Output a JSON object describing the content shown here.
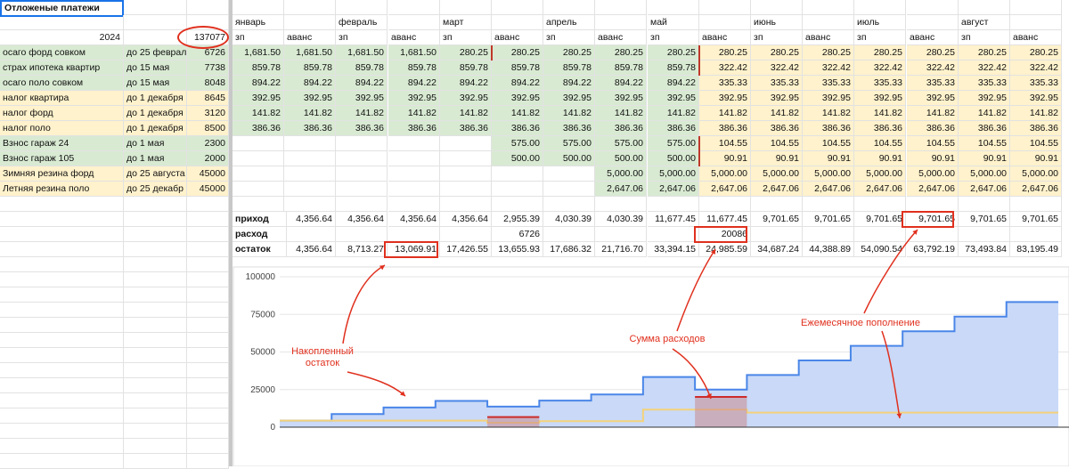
{
  "sheet": {
    "title": "Отложеные платежи",
    "year": "2024",
    "total": "137077",
    "months": [
      "январь",
      "февраль",
      "март",
      "апрель",
      "май",
      "июнь",
      "июль",
      "август"
    ],
    "subcols": [
      "зп",
      "аванс",
      "зп",
      "аванс",
      "зп",
      "аванс",
      "зп",
      "аванс",
      "зп",
      "аванс",
      "зп",
      "аванс",
      "зп",
      "аванс",
      "зп",
      "аванс"
    ],
    "items": [
      {
        "name": "осаго форд совком",
        "due": "до 25 феврал",
        "amount": "6726",
        "color": "green",
        "values": [
          "1,681.50",
          "1,681.50",
          "1,681.50",
          "1,681.50",
          "280.25",
          "280.25",
          "280.25",
          "280.25",
          "280.25",
          "280.25",
          "280.25",
          "280.25",
          "280.25",
          "280.25",
          "280.25",
          "280.25"
        ]
      },
      {
        "name": "страх ипотека квартир",
        "due": "до 15 мая",
        "amount": "7738",
        "color": "green",
        "values": [
          "859.78",
          "859.78",
          "859.78",
          "859.78",
          "859.78",
          "859.78",
          "859.78",
          "859.78",
          "859.78",
          "322.42",
          "322.42",
          "322.42",
          "322.42",
          "322.42",
          "322.42",
          "322.42"
        ]
      },
      {
        "name": "осаго поло совком",
        "due": "до 15 мая",
        "amount": "8048",
        "color": "green",
        "values": [
          "894.22",
          "894.22",
          "894.22",
          "894.22",
          "894.22",
          "894.22",
          "894.22",
          "894.22",
          "894.22",
          "335.33",
          "335.33",
          "335.33",
          "335.33",
          "335.33",
          "335.33",
          "335.33"
        ]
      },
      {
        "name": "налог квартира",
        "due": "до 1 декабря",
        "amount": "8645",
        "color": "yellow",
        "values": [
          "392.95",
          "392.95",
          "392.95",
          "392.95",
          "392.95",
          "392.95",
          "392.95",
          "392.95",
          "392.95",
          "392.95",
          "392.95",
          "392.95",
          "392.95",
          "392.95",
          "392.95",
          "392.95"
        ]
      },
      {
        "name": "налог форд",
        "due": "до 1 декабря",
        "amount": "3120",
        "color": "yellow",
        "values": [
          "141.82",
          "141.82",
          "141.82",
          "141.82",
          "141.82",
          "141.82",
          "141.82",
          "141.82",
          "141.82",
          "141.82",
          "141.82",
          "141.82",
          "141.82",
          "141.82",
          "141.82",
          "141.82"
        ]
      },
      {
        "name": "налог поло",
        "due": "до 1 декабря",
        "amount": "8500",
        "color": "yellow",
        "values": [
          "386.36",
          "386.36",
          "386.36",
          "386.36",
          "386.36",
          "386.36",
          "386.36",
          "386.36",
          "386.36",
          "386.36",
          "386.36",
          "386.36",
          "386.36",
          "386.36",
          "386.36",
          "386.36"
        ]
      },
      {
        "name": "Взнос гараж 24",
        "due": "до 1 мая",
        "amount": "2300",
        "color": "green",
        "values": [
          "",
          "",
          "",
          "",
          "",
          "575.00",
          "575.00",
          "575.00",
          "575.00",
          "104.55",
          "104.55",
          "104.55",
          "104.55",
          "104.55",
          "104.55",
          "104.55"
        ]
      },
      {
        "name": "Взнос гараж 105",
        "due": "до 1 мая",
        "amount": "2000",
        "color": "green",
        "values": [
          "",
          "",
          "",
          "",
          "",
          "500.00",
          "500.00",
          "500.00",
          "500.00",
          "90.91",
          "90.91",
          "90.91",
          "90.91",
          "90.91",
          "90.91",
          "90.91"
        ]
      },
      {
        "name": "Зимняя резина форд",
        "due": "до 25 августа",
        "amount": "45000",
        "color": "yellow",
        "values": [
          "",
          "",
          "",
          "",
          "",
          "",
          "",
          "5,000.00",
          "5,000.00",
          "5,000.00",
          "5,000.00",
          "5,000.00",
          "5,000.00",
          "5,000.00",
          "5,000.00",
          "5,000.00"
        ]
      },
      {
        "name": "Летняя резина поло",
        "due": "до 25 декабр",
        "amount": "45000",
        "color": "yellow",
        "values": [
          "",
          "",
          "",
          "",
          "",
          "",
          "",
          "2,647.06",
          "2,647.06",
          "2,647.06",
          "2,647.06",
          "2,647.06",
          "2,647.06",
          "2,647.06",
          "2,647.06",
          "2,647.06"
        ]
      }
    ],
    "summary": [
      {
        "label": "приход",
        "values": [
          "4,356.64",
          "4,356.64",
          "4,356.64",
          "4,356.64",
          "2,955.39",
          "4,030.39",
          "4,030.39",
          "11,677.45",
          "11,677.45",
          "9,701.65",
          "9,701.65",
          "9,701.65",
          "9,701.65",
          "9,701.65",
          "9,701.65"
        ]
      },
      {
        "label": "расход",
        "values": [
          "",
          "",
          "",
          "",
          "6726",
          "",
          "",
          "",
          "20086",
          "",
          "",
          "",
          "",
          "",
          ""
        ]
      },
      {
        "label": "остаток",
        "values": [
          "4,356.64",
          "8,713.27",
          "13,069.91",
          "17,426.55",
          "13,655.93",
          "17,686.32",
          "21,716.70",
          "33,394.15",
          "24,985.59",
          "34,687.24",
          "44,388.89",
          "54,090.54",
          "63,792.19",
          "73,493.84",
          "83,195.49"
        ]
      }
    ],
    "colors": {
      "green": "#d9ead3",
      "yellow": "#fff2cc",
      "red": "#e0301e",
      "blue": "#4a86e8"
    }
  },
  "chart_data": {
    "type": "area",
    "title": "",
    "xlabel": "",
    "ylabel": "",
    "ylim": [
      0,
      100000
    ],
    "yticks": [
      "100000",
      "75000",
      "50000",
      "25000",
      "0"
    ],
    "series": [
      {
        "values": [
          4356.64,
          8713.27,
          13069.91,
          17426.55,
          13655.93,
          17686.32,
          21716.7,
          33394.15,
          24985.59,
          34687.24,
          44388.89,
          54090.54,
          63792.19,
          73493.84,
          83195.49
        ]
      },
      {
        "values": [
          4356.64,
          4356.64,
          4356.64,
          4356.64,
          2955.39,
          4030.39,
          4030.39,
          11677.45,
          11677.45,
          9701.65,
          9701.65,
          9701.65,
          9701.65,
          9701.65,
          9701.65
        ]
      },
      {
        "values": [
          0,
          0,
          0,
          0,
          6726,
          0,
          0,
          0,
          20086,
          0,
          0,
          0,
          0,
          0,
          0
        ]
      }
    ]
  },
  "annotations": {
    "accumulated": "Накопленный остаток",
    "accumulated_line1": "Накопленный",
    "accumulated_line2": "остаток",
    "expenses": "Сумма расходов",
    "monthly": "Ежемесячное пополнение"
  }
}
